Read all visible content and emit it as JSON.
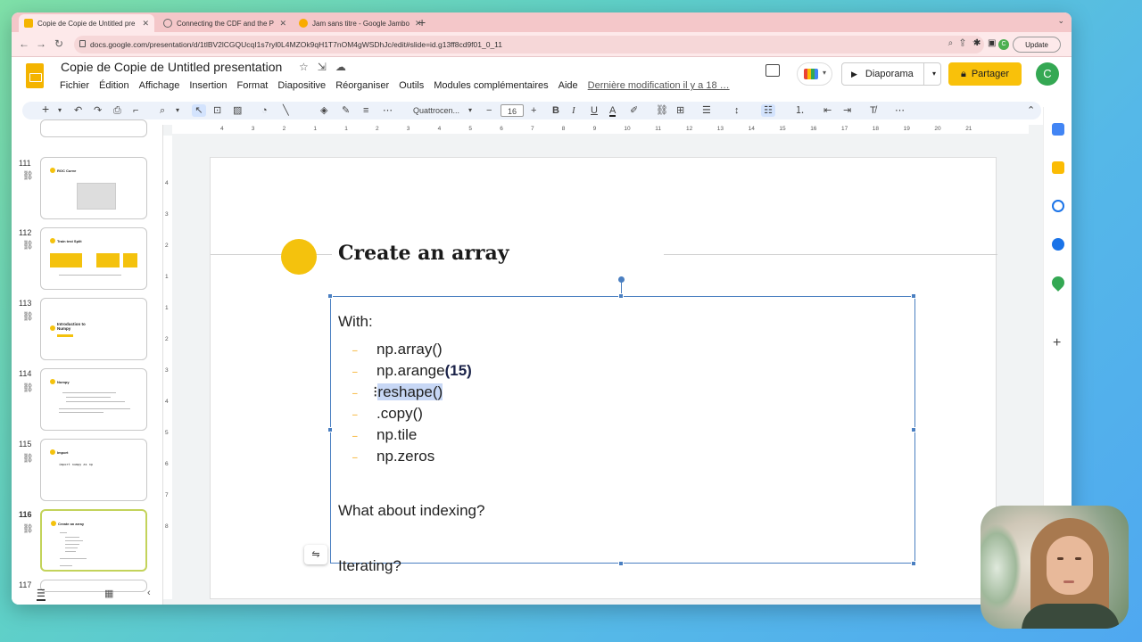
{
  "browser": {
    "tabs": [
      {
        "label": "Copie de Copie de Untitled pre",
        "active": true,
        "favicon_color": "#f4b400"
      },
      {
        "label": "Connecting the CDF and the P",
        "active": false,
        "favicon_color": "#666666"
      },
      {
        "label": "Jam sans titre - Google Jambo",
        "active": false,
        "favicon_color": "#f9ab00"
      }
    ],
    "url": "docs.google.com/presentation/d/1tlBV2lCGQUcqI1s7ryl0L4MZOk9qH1T7nOM4gWSDhJc/edit#slide=id.g13ff8cd9f01_0_11",
    "update_label": "Update",
    "profile_initial": "C"
  },
  "app": {
    "title": "Copie de Copie de Untitled presentation",
    "menus": [
      "Fichier",
      "Édition",
      "Affichage",
      "Insertion",
      "Format",
      "Diapositive",
      "Réorganiser",
      "Outils",
      "Modules complémentaires",
      "Aide"
    ],
    "last_modified": "Dernière modification il y a 18 …",
    "slideshow_label": "Diaporama",
    "share_label": "Partager",
    "avatar_initial": "C",
    "accent": "#f9c10a"
  },
  "toolbar": {
    "font_name": "Quattrocen...",
    "font_size": "16"
  },
  "ruler": {
    "horizontal": [
      "4",
      "3",
      "2",
      "1",
      "1",
      "2",
      "3",
      "4",
      "5",
      "6",
      "7",
      "8",
      "9",
      "10",
      "11",
      "12",
      "13",
      "14",
      "15",
      "16",
      "17",
      "18",
      "19",
      "20",
      "21"
    ],
    "vertical": [
      "4",
      "3",
      "2",
      "1",
      "1",
      "2",
      "3",
      "4",
      "5",
      "6",
      "7",
      "8"
    ]
  },
  "filmstrip": {
    "slides": [
      {
        "number": "111",
        "title": "ROC Curve"
      },
      {
        "number": "112",
        "title": "Train test Split"
      },
      {
        "number": "113",
        "title": "Introduction to Numpy"
      },
      {
        "number": "114",
        "title": "Numpy"
      },
      {
        "number": "115",
        "title": "Import",
        "code": "import numpy as np"
      },
      {
        "number": "116",
        "title": "Create an array",
        "current": true
      },
      {
        "number": "117",
        "title": ""
      }
    ]
  },
  "slide": {
    "title": "Create an array",
    "intro": "With:",
    "bullet_marker": "–",
    "items": [
      {
        "text": " np.array()"
      },
      {
        "text": "np.arange",
        "bold": "(15)"
      },
      {
        "caret": "⁝",
        "text": "reshape()",
        "highlighted": true
      },
      {
        "text": ".copy()"
      },
      {
        "text": "np.tile"
      },
      {
        "text": "np.zeros"
      }
    ],
    "question1": "What about indexing?",
    "question2": "Iterating?"
  }
}
